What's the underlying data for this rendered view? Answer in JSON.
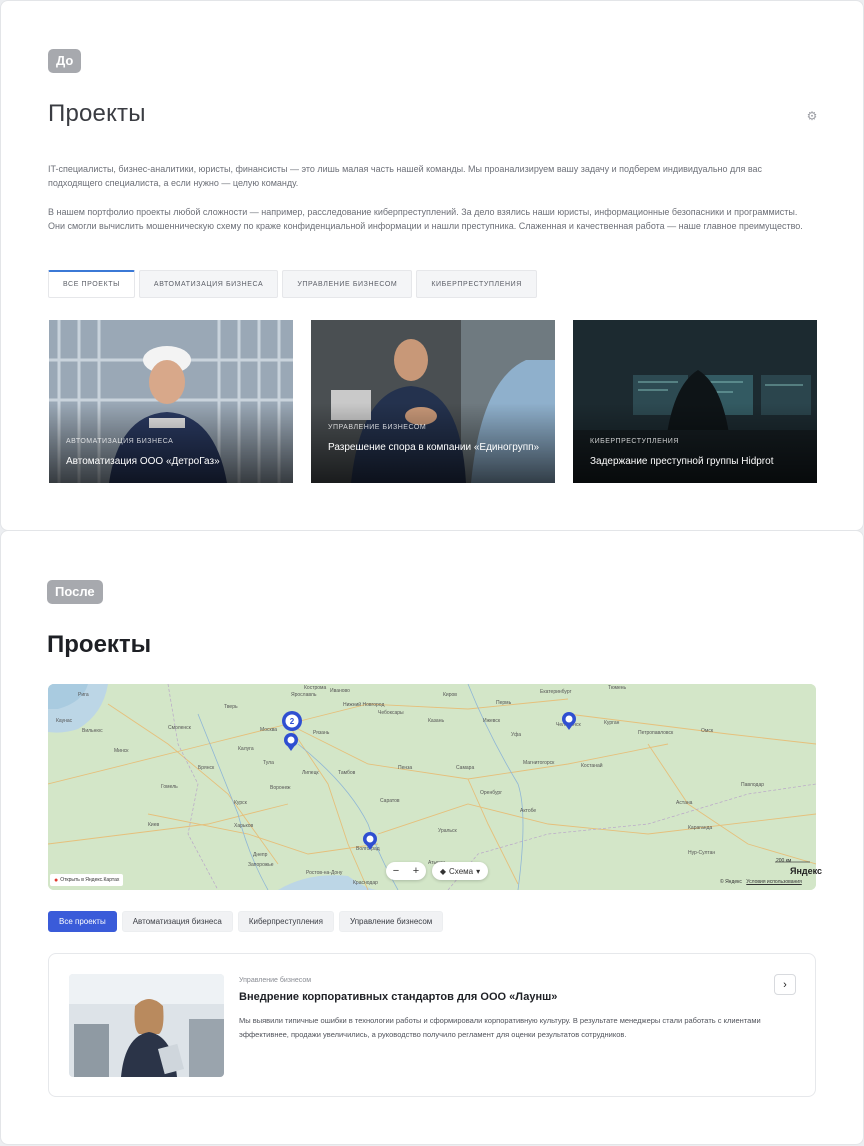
{
  "before": {
    "tag": "До",
    "title": "Проекты",
    "paragraph_1": "IT-специалисты, бизнес-аналитики, юристы, финансисты — это лишь малая часть нашей команды. Мы проанализируем вашу задачу и подберем индивидуально для вас подходящего специалиста, а если нужно — целую команду.",
    "paragraph_2": "В нашем портфолио проекты любой сложности — например, расследование киберпреступлений. За дело взялись наши юристы, информационные безопасники и программисты. Они смогли вычислить мошенническую схему по краже конфиденциальной информации и нашли преступника. Слаженная и качественная работа — наше главное преимущество.",
    "tabs": [
      "Все проекты",
      "Автоматизация бизнеса",
      "Управление бизнесом",
      "Киберпреступления"
    ],
    "cards": [
      {
        "category": "Автоматизация бизнеса",
        "title": "Автоматизация ООО «ДетроГаз»"
      },
      {
        "category": "Управление бизнесом",
        "title": "Разрешение спора в компании «Единогрупп»"
      },
      {
        "category": "Киберпреступления",
        "title": "Задержание преступной группы Hidprot"
      }
    ]
  },
  "after": {
    "tag": "После",
    "title": "Проекты",
    "map": {
      "cities": [
        "Екатеринбург",
        "Тюмень",
        "Челябинск",
        "Курган",
        "Петропавловск",
        "Омск",
        "Нижний Новгород",
        "Казань",
        "Чебоксары",
        "Уфа",
        "Самара",
        "Пенза",
        "Саратов",
        "Волгоград",
        "Воронеж",
        "Липецк",
        "Рязань",
        "Москва",
        "Тверь",
        "Калуга",
        "Смоленск",
        "Брянск",
        "Курск",
        "Харьков",
        "Днепр",
        "Запорожье",
        "Ростов-на-Дону",
        "Краснодар",
        "Оренбург",
        "Магнитогорск",
        "Костанай",
        "Уральск",
        "Актобе",
        "Астана",
        "Караганда",
        "Павлодар",
        "Киев",
        "Минск",
        "Вильнюс",
        "Рига",
        "Каунас",
        "Гомель",
        "Ярославль",
        "Иваново",
        "Кострома",
        "Тамбов",
        "Тула",
        "Пермь",
        "Киров",
        "Ижевск",
        "Нур-Султан",
        "Атырау"
      ],
      "cluster_count": "2",
      "zoom_out": "−",
      "zoom_in": "+",
      "layer_label": "Схема",
      "open_link": "Открыть в Яндекс.Картах",
      "copyright": "© Яндекс",
      "terms": "Условия использования",
      "logo": "Яндекс",
      "scale": "200 км"
    },
    "filters": [
      "Все проекты",
      "Автоматизация бизнеса",
      "Киберпреступления",
      "Управление бизнесом"
    ],
    "project": {
      "category": "Управление бизнесом",
      "title": "Внедрение корпоративных стандартов для ООО «Лаунш»",
      "description": "Мы выявили типичные ошибки в технологии работы и сформировали корпоративную культуру. В результате менеджеры стали работать с клиентами эффективнее, продажи увеличились, а руководство получило регламент для оценки результатов сотрудников.",
      "arrow": "›"
    }
  },
  "colors": {
    "accent": "#3a5bd9",
    "tab_indicator": "#3b79d6",
    "pin": "#2f4fd1"
  }
}
